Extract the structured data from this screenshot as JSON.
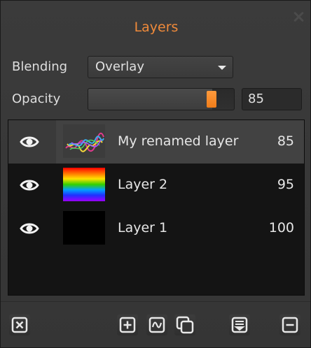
{
  "panel": {
    "title": "Layers"
  },
  "blending": {
    "label": "Blending",
    "selected": "Overlay"
  },
  "opacity": {
    "label": "Opacity",
    "value": "85",
    "fraction": 0.85
  },
  "layers": [
    {
      "name": "My renamed layer",
      "opacity": "85",
      "visible": true,
      "selected": true,
      "thumbnail": "scribble"
    },
    {
      "name": "Layer 2",
      "opacity": "95",
      "visible": true,
      "selected": false,
      "thumbnail": "rainbow-gradient"
    },
    {
      "name": "Layer 1",
      "opacity": "100",
      "visible": true,
      "selected": false,
      "thumbnail": "black"
    }
  ],
  "toolbar": {
    "buttons": [
      {
        "icon": "delete-all-icon"
      },
      {
        "icon": "add-layer-icon"
      },
      {
        "icon": "adjustment-layer-icon"
      },
      {
        "icon": "duplicate-layer-icon"
      },
      {
        "icon": "merge-down-icon"
      },
      {
        "icon": "remove-layer-icon"
      }
    ]
  },
  "colors": {
    "accent": "#f08a3a",
    "panel_bg": "#383838",
    "list_bg": "#141414",
    "selected_row": "#424242"
  }
}
